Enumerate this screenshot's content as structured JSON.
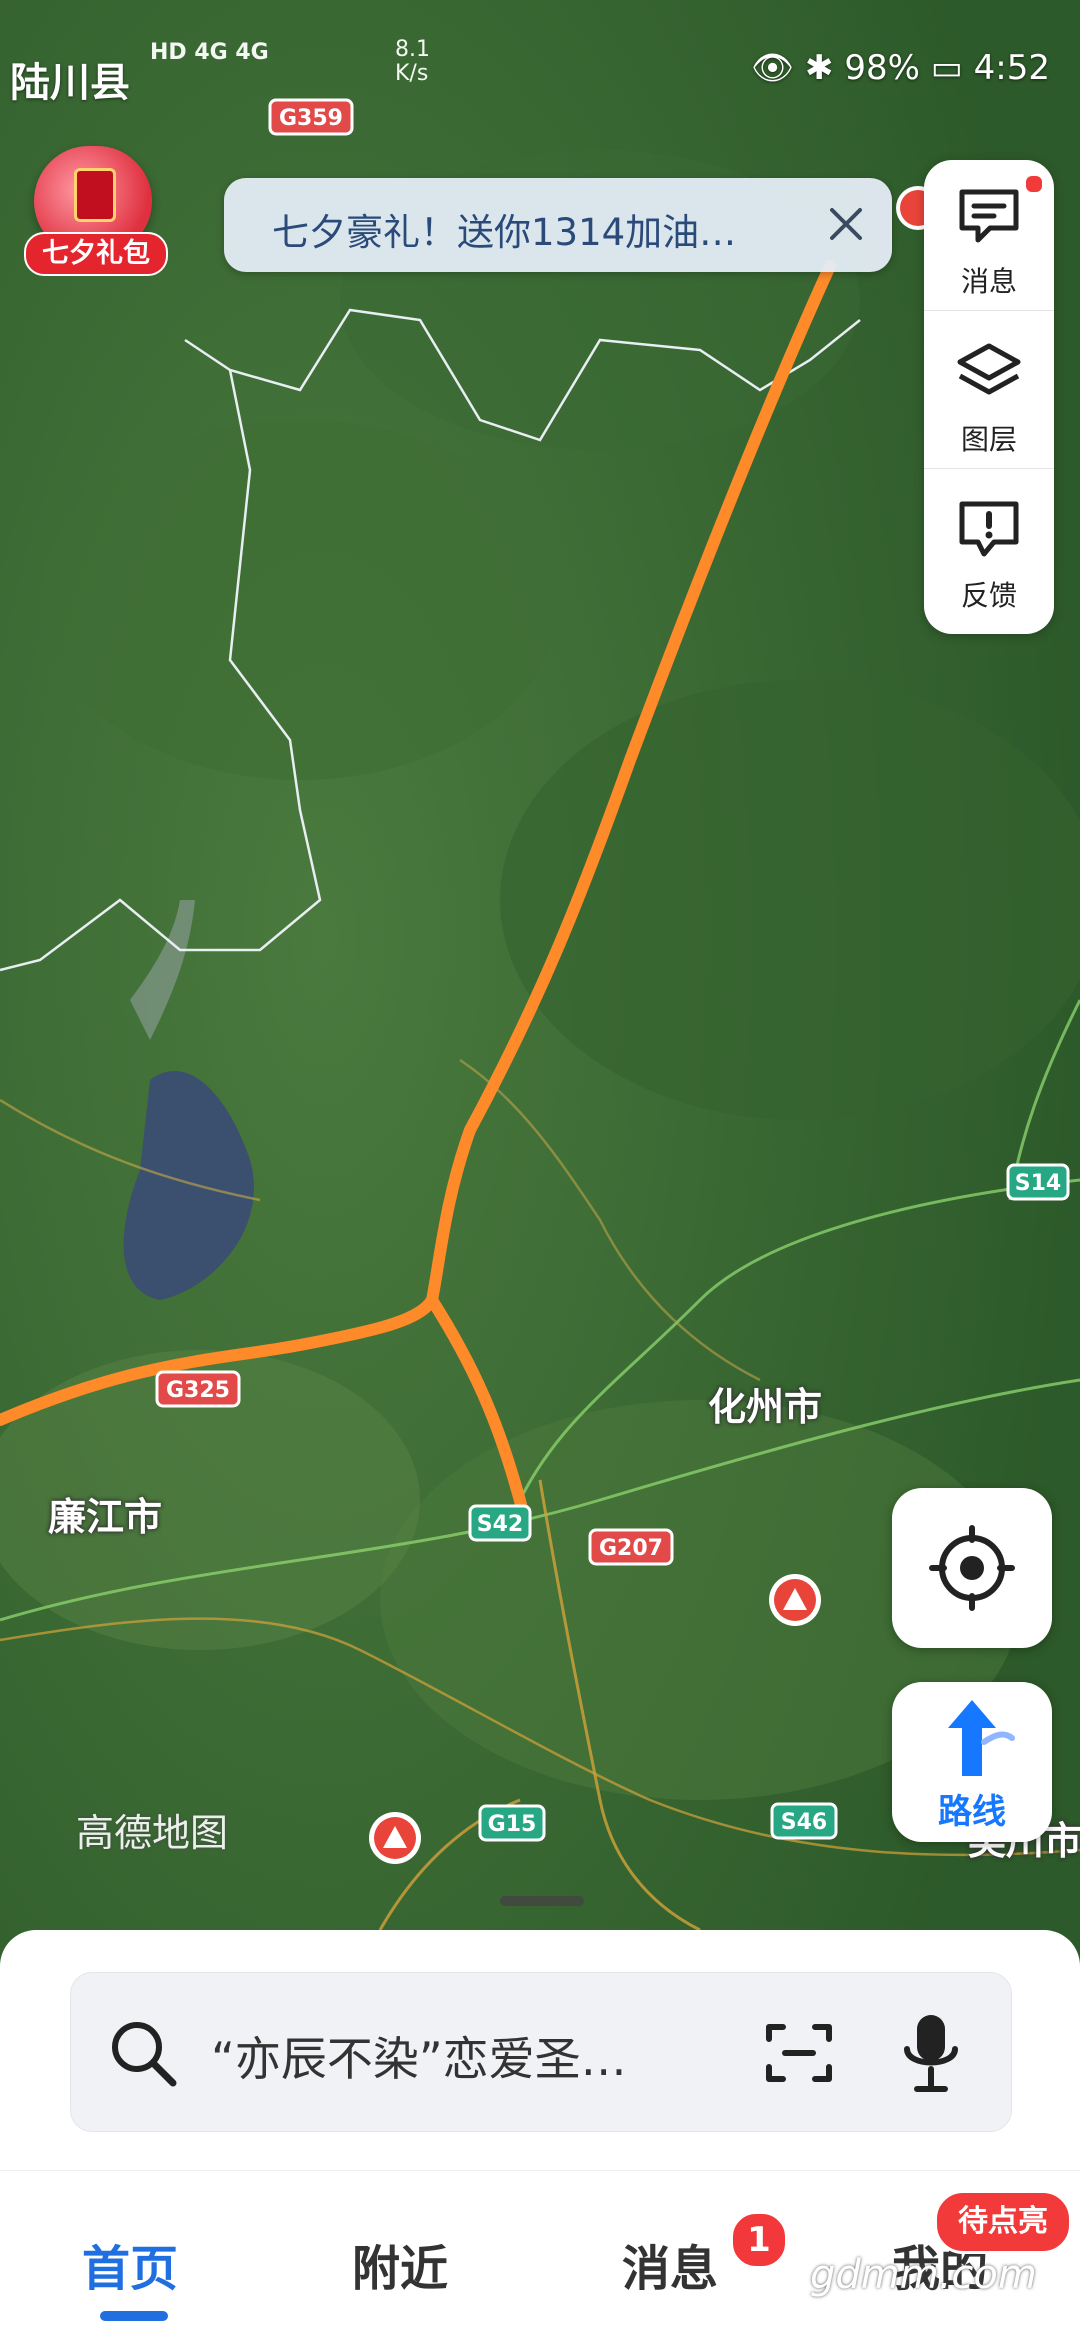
{
  "status_bar": {
    "location": "陆川县",
    "network": "HD 4G 4G",
    "speed_value": "8.1",
    "speed_unit": "K/s",
    "battery": "98%",
    "time": "4:52"
  },
  "promo": {
    "label": "七夕礼包"
  },
  "banner": {
    "text": "七夕豪礼！送你1314加油…"
  },
  "side_panel": {
    "items": [
      {
        "label": "消息",
        "icon": "message-icon"
      },
      {
        "label": "图层",
        "icon": "layers-icon"
      },
      {
        "label": "反馈",
        "icon": "feedback-icon"
      }
    ]
  },
  "map": {
    "city_labels": [
      "化州市",
      "廉江市"
    ],
    "road_shields": [
      "G359",
      "G325",
      "S14",
      "S42",
      "G207",
      "G15",
      "S46"
    ],
    "watermark": "高德地图",
    "partial_label_right": "吴川市",
    "colors": {
      "route": "#ff8a2a",
      "map_green": "#3d6b36"
    }
  },
  "buttons": {
    "route_label": "路线"
  },
  "search": {
    "placeholder": "“亦辰不染”恋爱圣…"
  },
  "tabs": [
    {
      "label": "首页",
      "active": true
    },
    {
      "label": "附近",
      "active": false
    },
    {
      "label": "消息",
      "active": false,
      "badge": "1"
    },
    {
      "label": "我的",
      "active": false,
      "badge": "待点亮"
    }
  ],
  "watermark_bottom": "gdmm.com"
}
